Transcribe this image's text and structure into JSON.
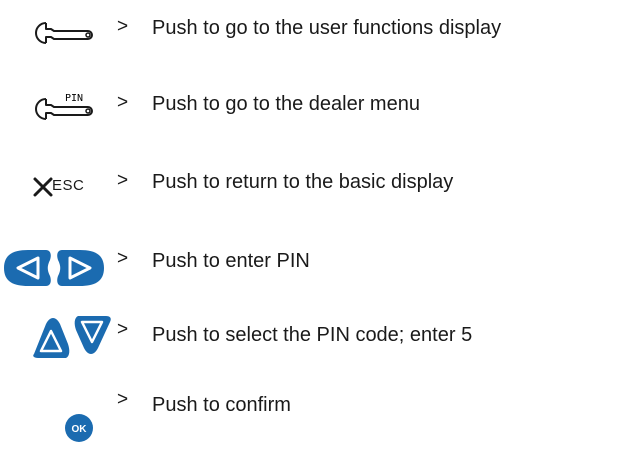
{
  "instructions": [
    {
      "icon": "wrench-icon",
      "arrow": ">",
      "text": "Push to go to the user functions display"
    },
    {
      "icon": "wrench-pin-icon",
      "icon_label": "PIN",
      "arrow": ">",
      "text": "Push to go to the dealer menu"
    },
    {
      "icon": "esc-icon",
      "icon_label": "ESC",
      "arrow": ">",
      "text": "Push to return to the basic display"
    },
    {
      "icon": "left-right-buttons-icon",
      "arrow": ">",
      "text": "Push to enter PIN"
    },
    {
      "icon": "up-down-buttons-icon",
      "arrow": ">",
      "text": "Push to select the PIN code; enter 5"
    },
    {
      "icon": "ok-button-icon",
      "icon_label": "OK",
      "arrow": ">",
      "text": "Push to confirm"
    }
  ],
  "colors": {
    "button_blue": "#1b6bb0",
    "text": "#1a1a1a"
  }
}
